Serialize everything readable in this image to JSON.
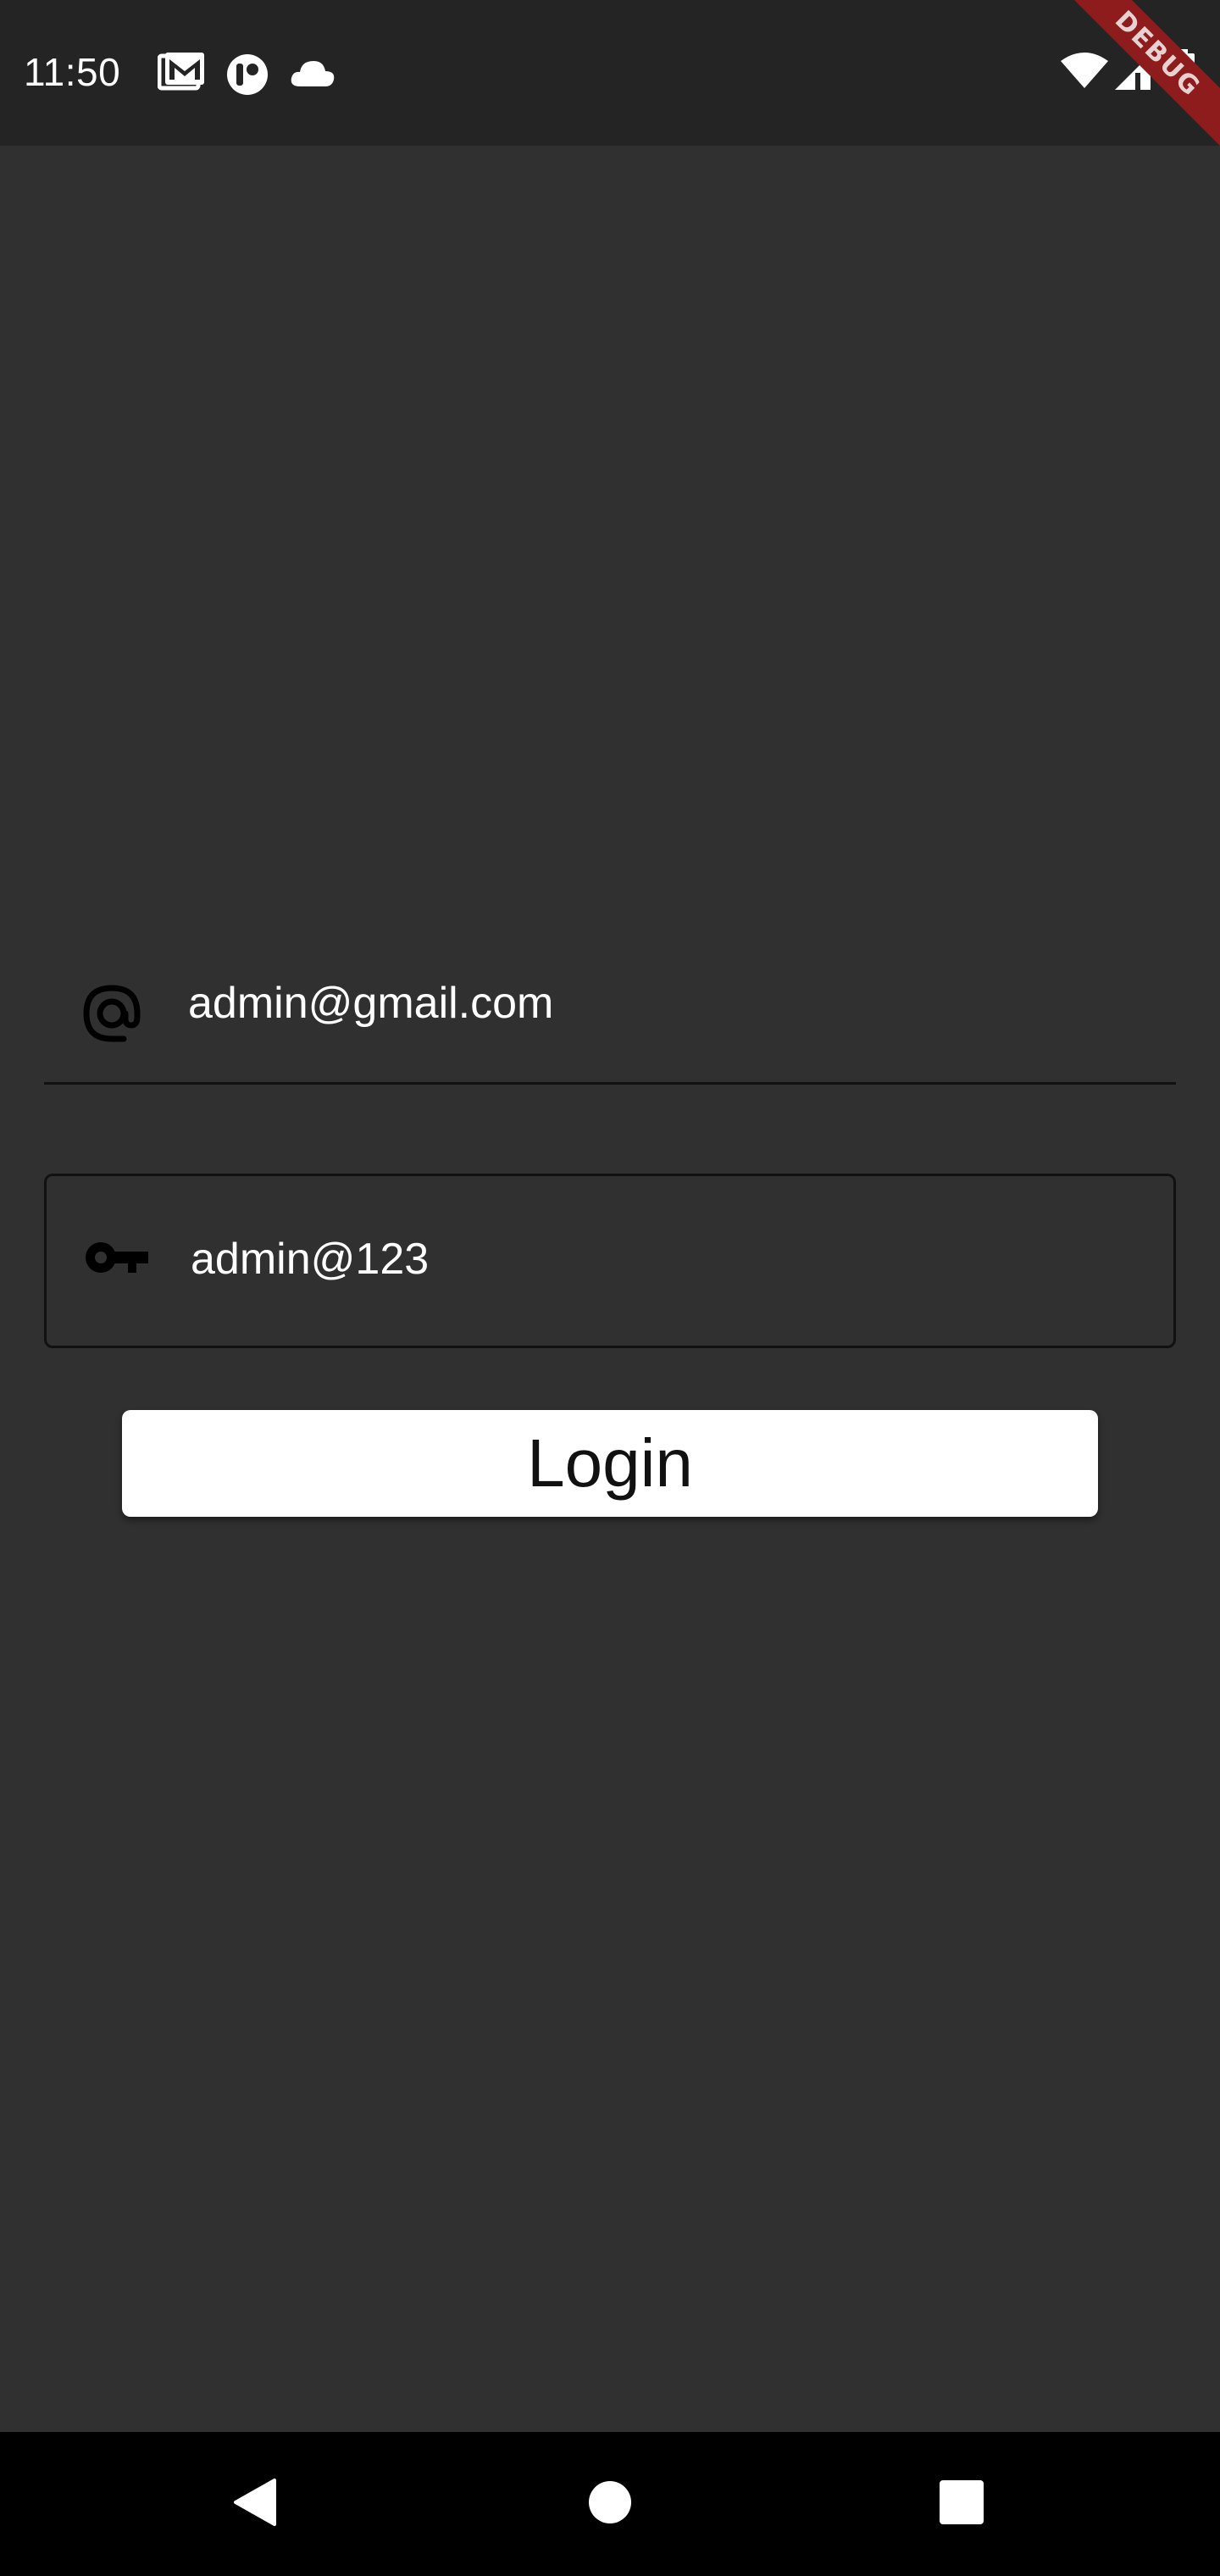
{
  "status_bar": {
    "time": "11:50",
    "left_icons": [
      "gmail-icon",
      "app-icon",
      "cloud-icon"
    ],
    "right_icons": [
      "wifi-icon",
      "signal-icon",
      "battery-icon"
    ]
  },
  "debug_banner": {
    "label": "DEBUG",
    "color": "#8e1c1c"
  },
  "login_form": {
    "email": {
      "value": "admin@gmail.com",
      "icon": "at-sign-icon"
    },
    "password": {
      "value": "admin@123",
      "icon": "key-icon"
    },
    "login_button_label": "Login"
  },
  "nav_bar": {
    "buttons": [
      "back-icon",
      "home-icon",
      "recents-icon"
    ]
  },
  "colors": {
    "background": "#303030",
    "status_bar": "#242424",
    "button": "#ffffff",
    "text": "#ffffff"
  }
}
